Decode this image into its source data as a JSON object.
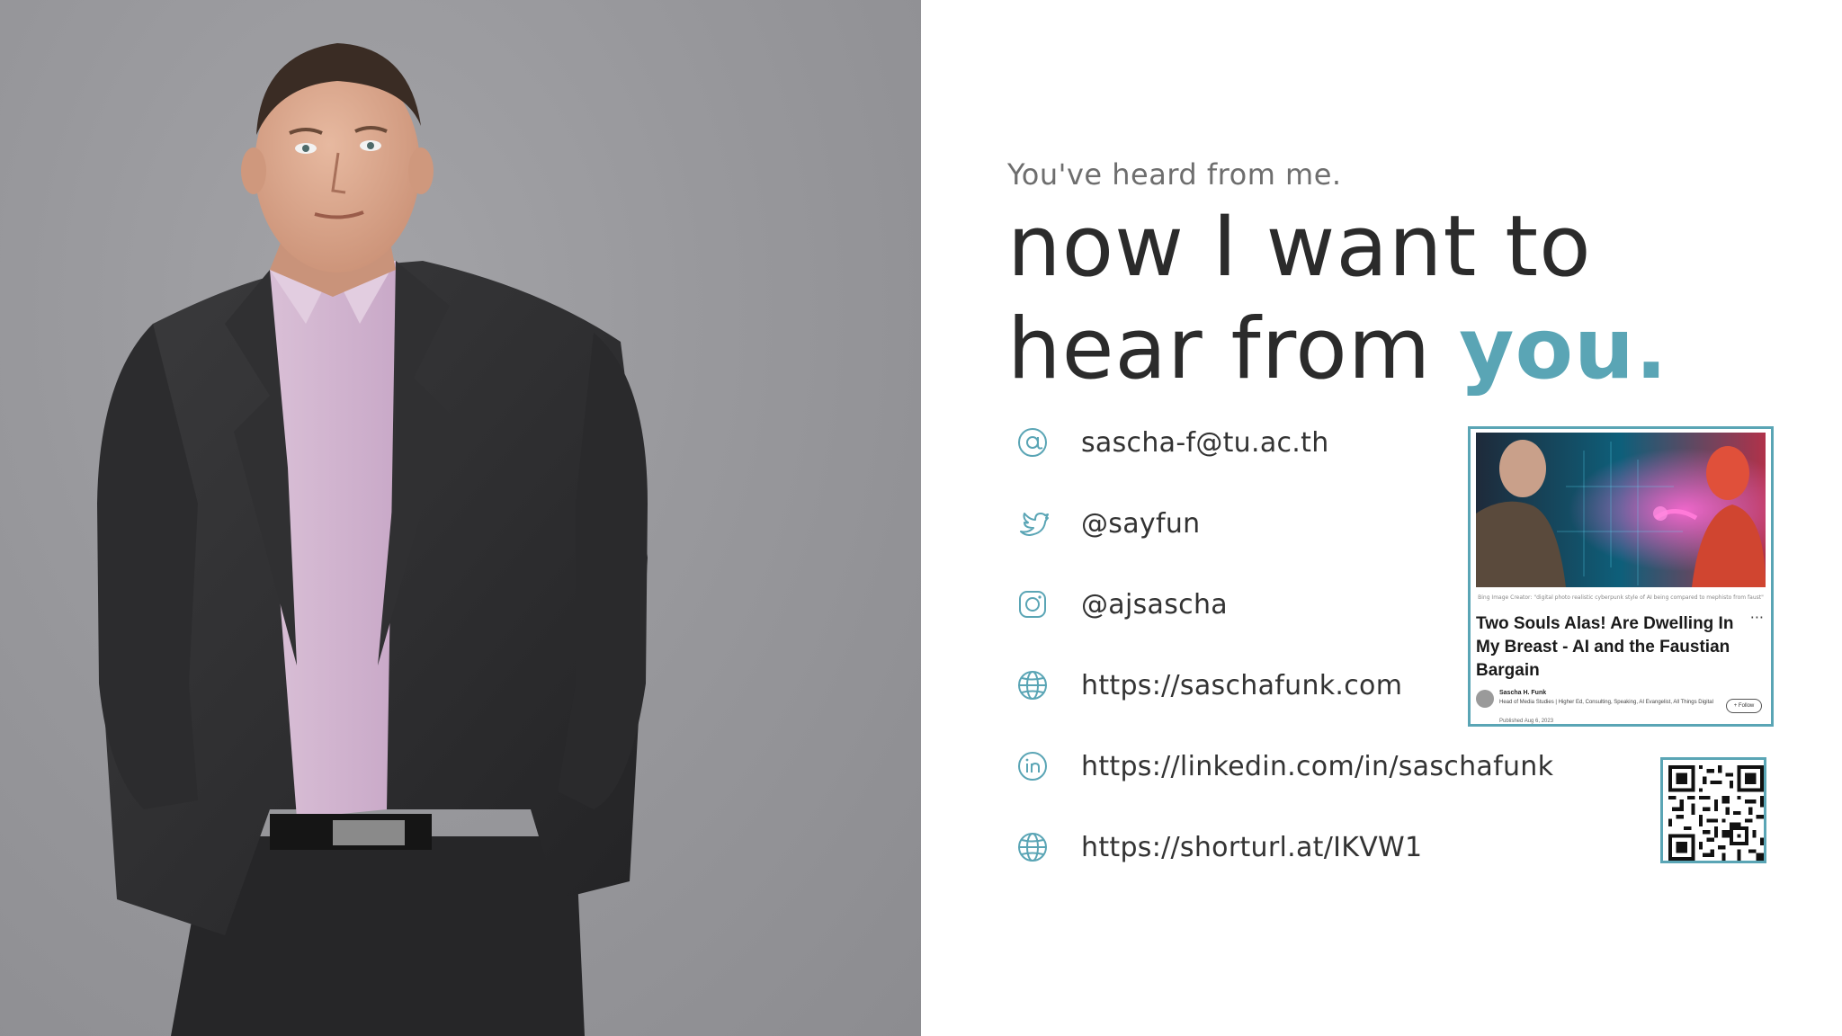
{
  "heading": {
    "subtitle": "You've heard from me.",
    "line1": "now I want to",
    "line2_prefix": "hear from ",
    "line2_accent": "you."
  },
  "colors": {
    "accent": "#5aa5b5",
    "text": "#2b2b2b",
    "subtitle": "#6e6e6e",
    "icon": "#5aa5b5"
  },
  "contacts": [
    {
      "icon": "at-sign-icon",
      "text": "sascha-f@tu.ac.th"
    },
    {
      "icon": "twitter-icon",
      "text": "@sayfun"
    },
    {
      "icon": "instagram-icon",
      "text": "@ajsascha"
    },
    {
      "icon": "globe-icon",
      "text": "https://saschafunk.com"
    },
    {
      "icon": "linkedin-icon",
      "text": "https://linkedin.com/in/saschafunk"
    },
    {
      "icon": "globe-icon",
      "text": "https://shorturl.at/IKVW1"
    }
  ],
  "article": {
    "image_caption": "Bing Image Creator: \"digital photo realistic cyberpunk style of AI being compared to mephisto from faust\"",
    "title": "Two Souls Alas! Are Dwelling In My Breast - AI and the Faustian Bargain",
    "more": "···",
    "author": "Sascha H. Funk",
    "author_role": "Head of Media Studies | Higher Ed, Consulting, Speaking, AI Evangelist, All Things Digital",
    "published": "Published Aug 6, 2023",
    "follow_label": "+ Follow"
  }
}
